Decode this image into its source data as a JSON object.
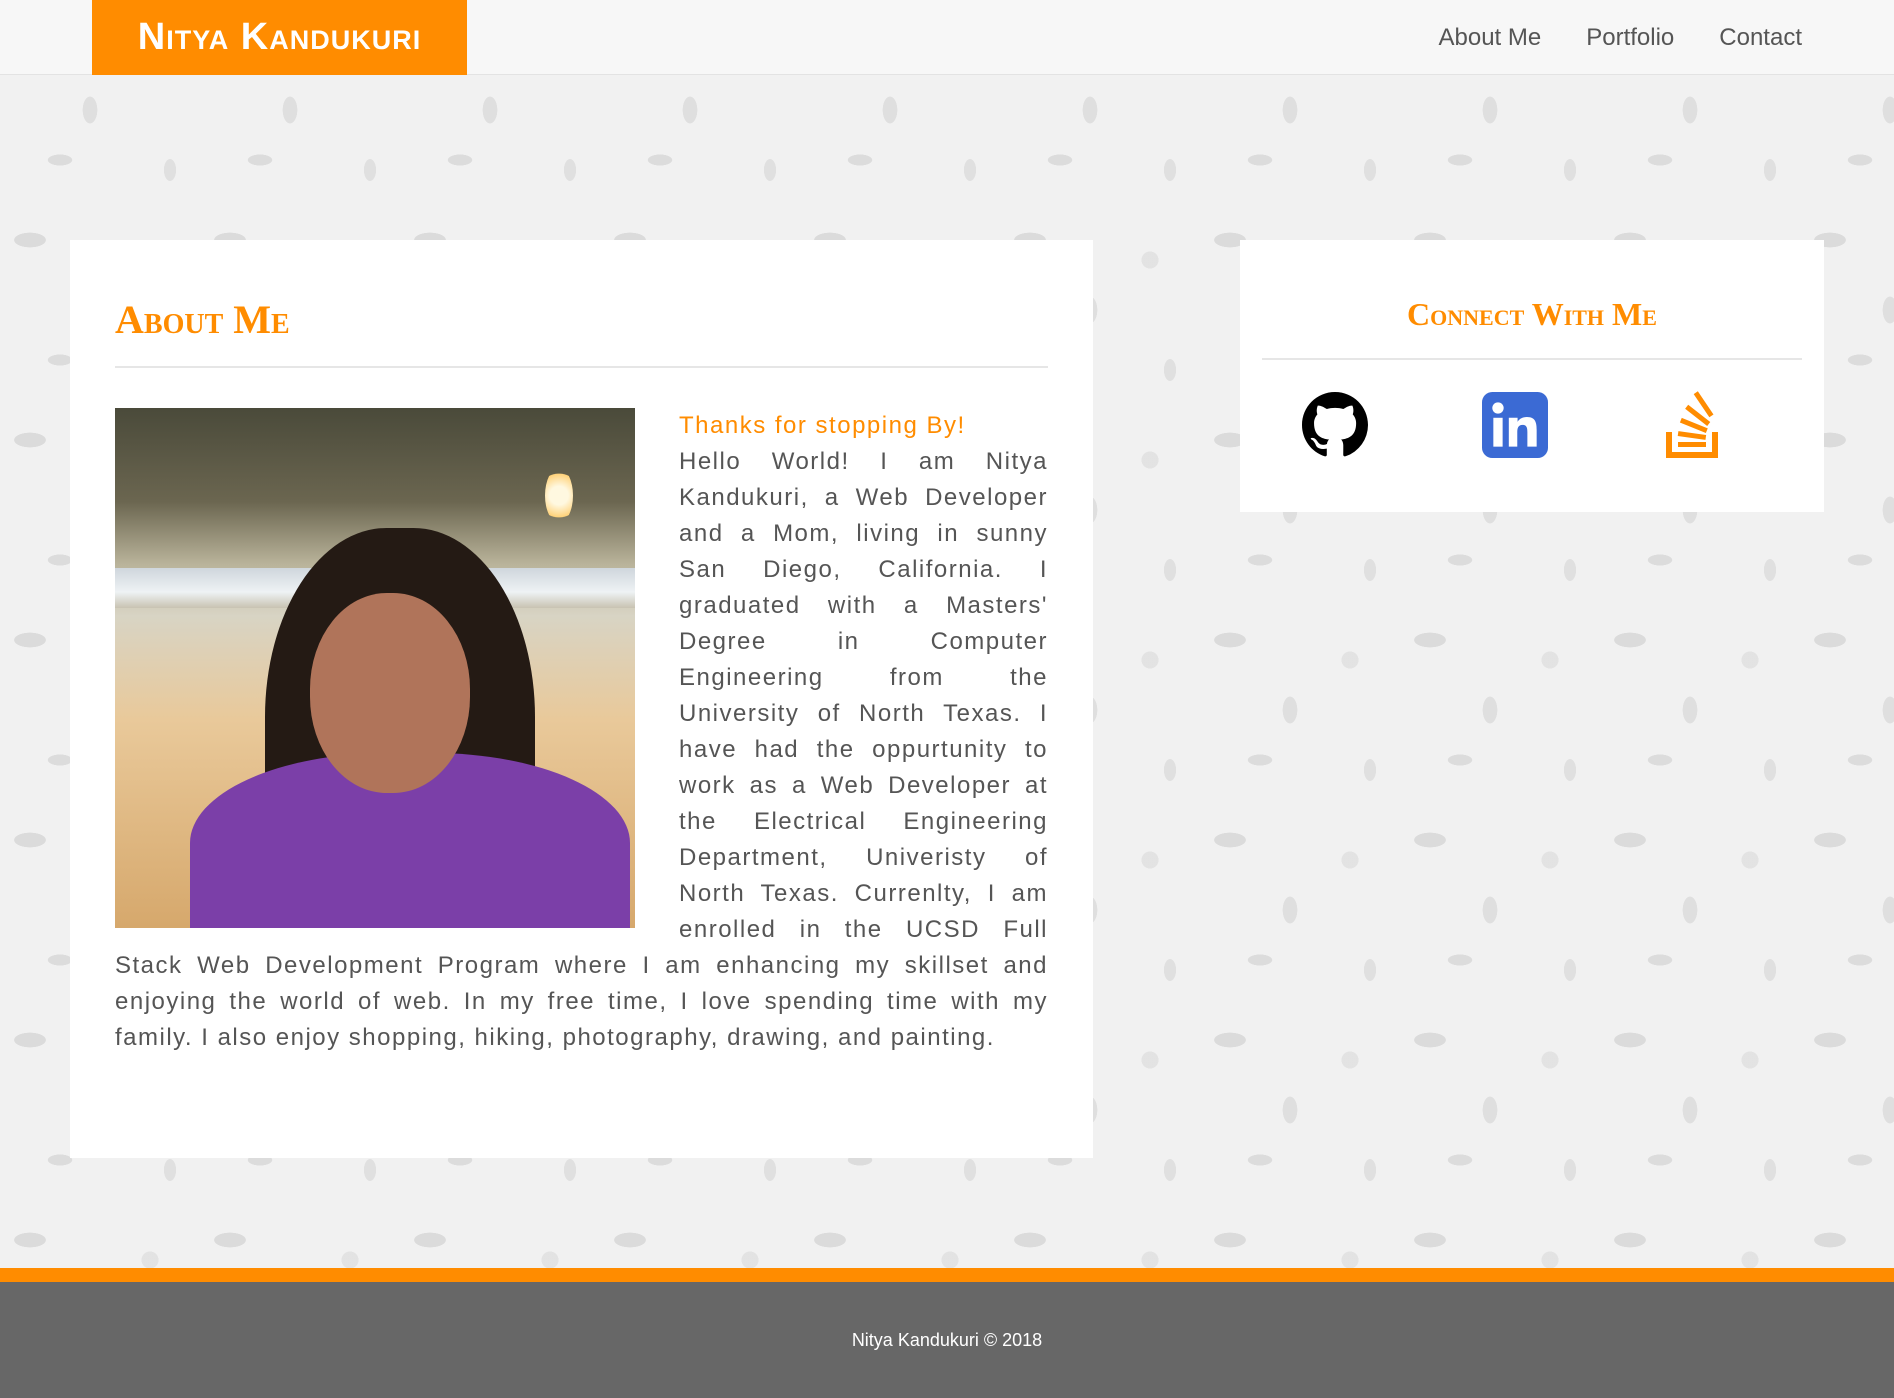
{
  "nav": {
    "brand": "Nitya Kandukuri",
    "links": [
      "About Me",
      "Portfolio",
      "Contact"
    ]
  },
  "about": {
    "title": "About Me",
    "lead": "Thanks for stopping By!",
    "text": "Hello World! I am Nitya Kandukuri, a Web Developer and a Mom, living in sunny San Diego, California. I graduated with a Masters' Degree in Computer Engineering from the University of North Texas. I have had the oppurtunity to work as a Web Developer at the Electrical Engineering Department, Univeristy of North Texas. Currenlty, I am enrolled in the UCSD Full Stack Web Development Program where I am enhancing my skillset and enjoying the world of web. In my free time, I love spending time with my family. I also enjoy shopping, hiking, photography, drawing, and painting."
  },
  "connect": {
    "title": "Connect With Me",
    "icons": [
      "github-icon",
      "linkedin-icon",
      "stackoverflow-icon"
    ]
  },
  "footer": {
    "text": "Nitya Kandukuri © 2018"
  },
  "colors": {
    "accent": "#ff8c00",
    "footer_bg": "#676767",
    "linkedin": "#3b6ad4"
  }
}
